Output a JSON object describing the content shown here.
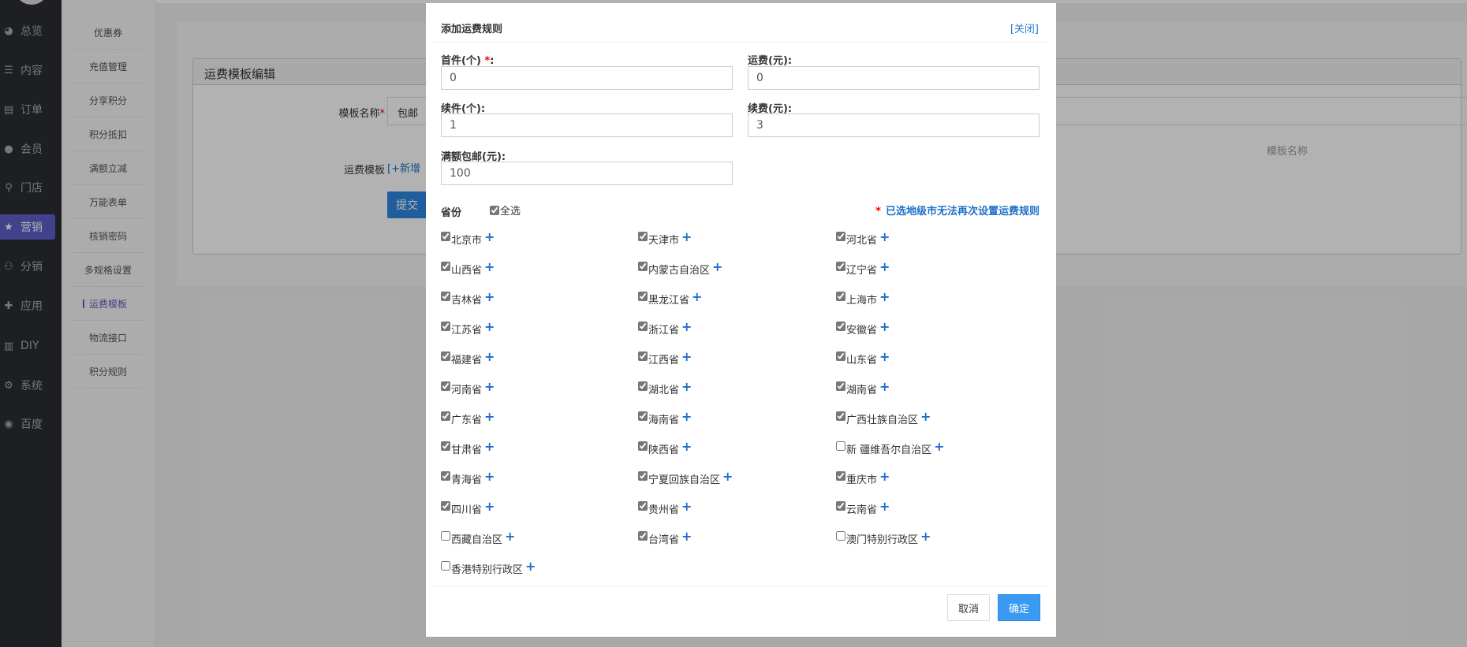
{
  "sidebar": {
    "items": [
      {
        "label": "总览",
        "icon": "pie-chart-icon"
      },
      {
        "label": "内容",
        "icon": "list-icon"
      },
      {
        "label": "订单",
        "icon": "document-icon"
      },
      {
        "label": "会员",
        "icon": "user-icon"
      },
      {
        "label": "门店",
        "icon": "map-pin-icon"
      },
      {
        "label": "营销",
        "icon": "star-icon",
        "active": true
      },
      {
        "label": "分销",
        "icon": "users-icon"
      },
      {
        "label": "应用",
        "icon": "puzzle-icon"
      },
      {
        "label": "DIY",
        "icon": "layout-icon"
      },
      {
        "label": "系统",
        "icon": "gear-icon"
      },
      {
        "label": "百度",
        "icon": "compass-icon"
      }
    ]
  },
  "submenu": {
    "items": [
      "优惠券",
      "充值管理",
      "分享积分",
      "积分抵扣",
      "满额立减",
      "万能表单",
      "核销密码",
      "多规格设置",
      "运费模板",
      "物流接口",
      "积分规则"
    ],
    "active": "运费模板"
  },
  "page": {
    "box_title": "运费模板编辑",
    "name_label": "模板名称",
    "name_req": "*",
    "name_value": "包邮",
    "name_placeholder": "模板名称",
    "template_label": "运费模板",
    "add_link": "[+新增",
    "submit": "提交"
  },
  "modal": {
    "title": "添加运费规则",
    "close": "[关闭]",
    "first_qty_label": "首件(个)",
    "first_qty_req": "*",
    "colon": ":",
    "first_qty": "0",
    "first_fee_label": "运费(元):",
    "first_fee": "0",
    "extra_qty_label": "续件(个):",
    "extra_qty": "1",
    "extra_fee_label": "续费(元):",
    "extra_fee": "3",
    "free_label": "满额包邮(元):",
    "free_value": "100",
    "province_label": "省份",
    "select_all": "全选",
    "note_star": "*",
    "note": "已选地级市无法再次设置运费规则",
    "plus": "+",
    "provinces": [
      {
        "name": "北京市",
        "checked": true
      },
      {
        "name": "天津市",
        "checked": true
      },
      {
        "name": "河北省",
        "checked": true
      },
      {
        "name": "山西省",
        "checked": true
      },
      {
        "name": "内蒙古自治区",
        "checked": true
      },
      {
        "name": "辽宁省",
        "checked": true
      },
      {
        "name": "吉林省",
        "checked": true
      },
      {
        "name": "黑龙江省",
        "checked": true
      },
      {
        "name": "上海市",
        "checked": true
      },
      {
        "name": "江苏省",
        "checked": true
      },
      {
        "name": "浙江省",
        "checked": true
      },
      {
        "name": "安徽省",
        "checked": true
      },
      {
        "name": "福建省",
        "checked": true
      },
      {
        "name": "江西省",
        "checked": true
      },
      {
        "name": "山东省",
        "checked": true
      },
      {
        "name": "河南省",
        "checked": true
      },
      {
        "name": "湖北省",
        "checked": true
      },
      {
        "name": "湖南省",
        "checked": true
      },
      {
        "name": "广东省",
        "checked": true
      },
      {
        "name": "海南省",
        "checked": true
      },
      {
        "name": "广西壮族自治区",
        "checked": true
      },
      {
        "name": "甘肃省",
        "checked": true
      },
      {
        "name": "陕西省",
        "checked": true
      },
      {
        "name": "新 疆维吾尔自治区",
        "checked": false
      },
      {
        "name": "青海省",
        "checked": true
      },
      {
        "name": "宁夏回族自治区",
        "checked": true
      },
      {
        "name": "重庆市",
        "checked": true
      },
      {
        "name": "四川省",
        "checked": true
      },
      {
        "name": "贵州省",
        "checked": true
      },
      {
        "name": "云南省",
        "checked": true
      },
      {
        "name": "西藏自治区",
        "checked": false
      },
      {
        "name": "台湾省",
        "checked": true
      },
      {
        "name": "澳门特别行政区",
        "checked": false
      },
      {
        "name": "香港特别行政区",
        "checked": false
      }
    ],
    "cancel": "取消",
    "confirm": "确定"
  }
}
